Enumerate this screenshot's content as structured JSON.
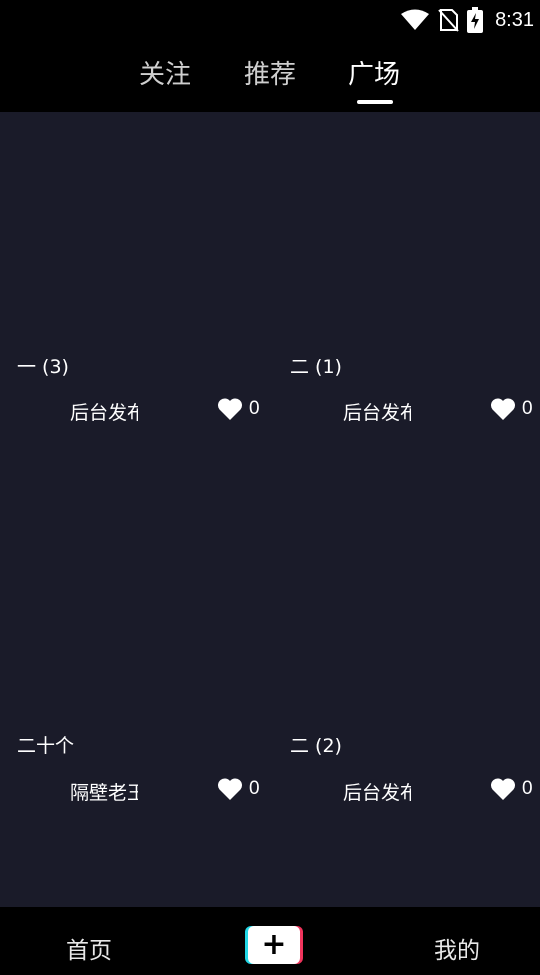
{
  "status_bar": {
    "time": "8:31"
  },
  "tabs": [
    {
      "label": "关注",
      "active": false
    },
    {
      "label": "推荐",
      "active": false
    },
    {
      "label": "广场",
      "active": true
    }
  ],
  "posts": [
    {
      "title": "一 (3)",
      "author": "后台发布",
      "likes": "0"
    },
    {
      "title": "二 (1)",
      "author": "后台发布",
      "likes": "0"
    },
    {
      "title": "二十个",
      "author": "隔壁老王",
      "likes": "0"
    },
    {
      "title": "二 (2)",
      "author": "后台发布",
      "likes": "0"
    }
  ],
  "bottom_nav": {
    "home": "首页",
    "add": "+",
    "mine": "我的"
  },
  "colors": {
    "background": "#1a1b29",
    "accent_cyan": "#22d7e6",
    "accent_pink": "#f0345c"
  }
}
